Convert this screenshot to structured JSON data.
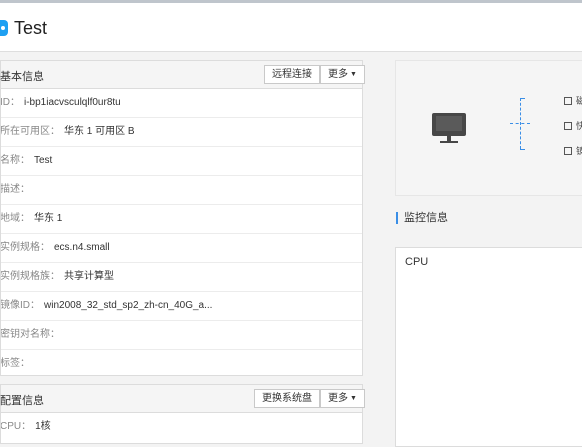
{
  "header": {
    "title": "Test"
  },
  "basic_info": {
    "title": "基本信息",
    "buttons": {
      "remote": "远程连接",
      "more": "更多"
    },
    "rows": [
      {
        "label": "ID：",
        "value": "i-bp1iacvsculqlf0ur8tu"
      },
      {
        "label": "所在可用区：",
        "value": "华东 1 可用区 B"
      },
      {
        "label": "名称：",
        "value": "Test"
      },
      {
        "label": "描述：",
        "value": ""
      },
      {
        "label": "地域：",
        "value": "华东 1"
      },
      {
        "label": "实例规格：",
        "value": "ecs.n4.small"
      },
      {
        "label": "实例规格族：",
        "value": "共享计算型"
      },
      {
        "label": "镜像ID：",
        "value": "win2008_32_std_sp2_zh-cn_40G_a..."
      },
      {
        "label": "密钥对名称：",
        "value": ""
      },
      {
        "label": "标签：",
        "value": ""
      }
    ]
  },
  "config_info": {
    "title": "配置信息",
    "buttons": {
      "change_disk": "更换系统盘",
      "more": "更多"
    },
    "rows": [
      {
        "label": "CPU：",
        "value": "1核"
      }
    ]
  },
  "illustration": {
    "items": [
      {
        "icon": "disk-icon",
        "label": "磁"
      },
      {
        "icon": "snapshot-icon",
        "label": "快"
      },
      {
        "icon": "security-icon",
        "label": "镜"
      }
    ]
  },
  "monitoring": {
    "title": "监控信息",
    "cpu_label": "CPU"
  },
  "colors": {
    "accent": "#3a8ee6",
    "brand_icon": "#1ea0f2"
  }
}
